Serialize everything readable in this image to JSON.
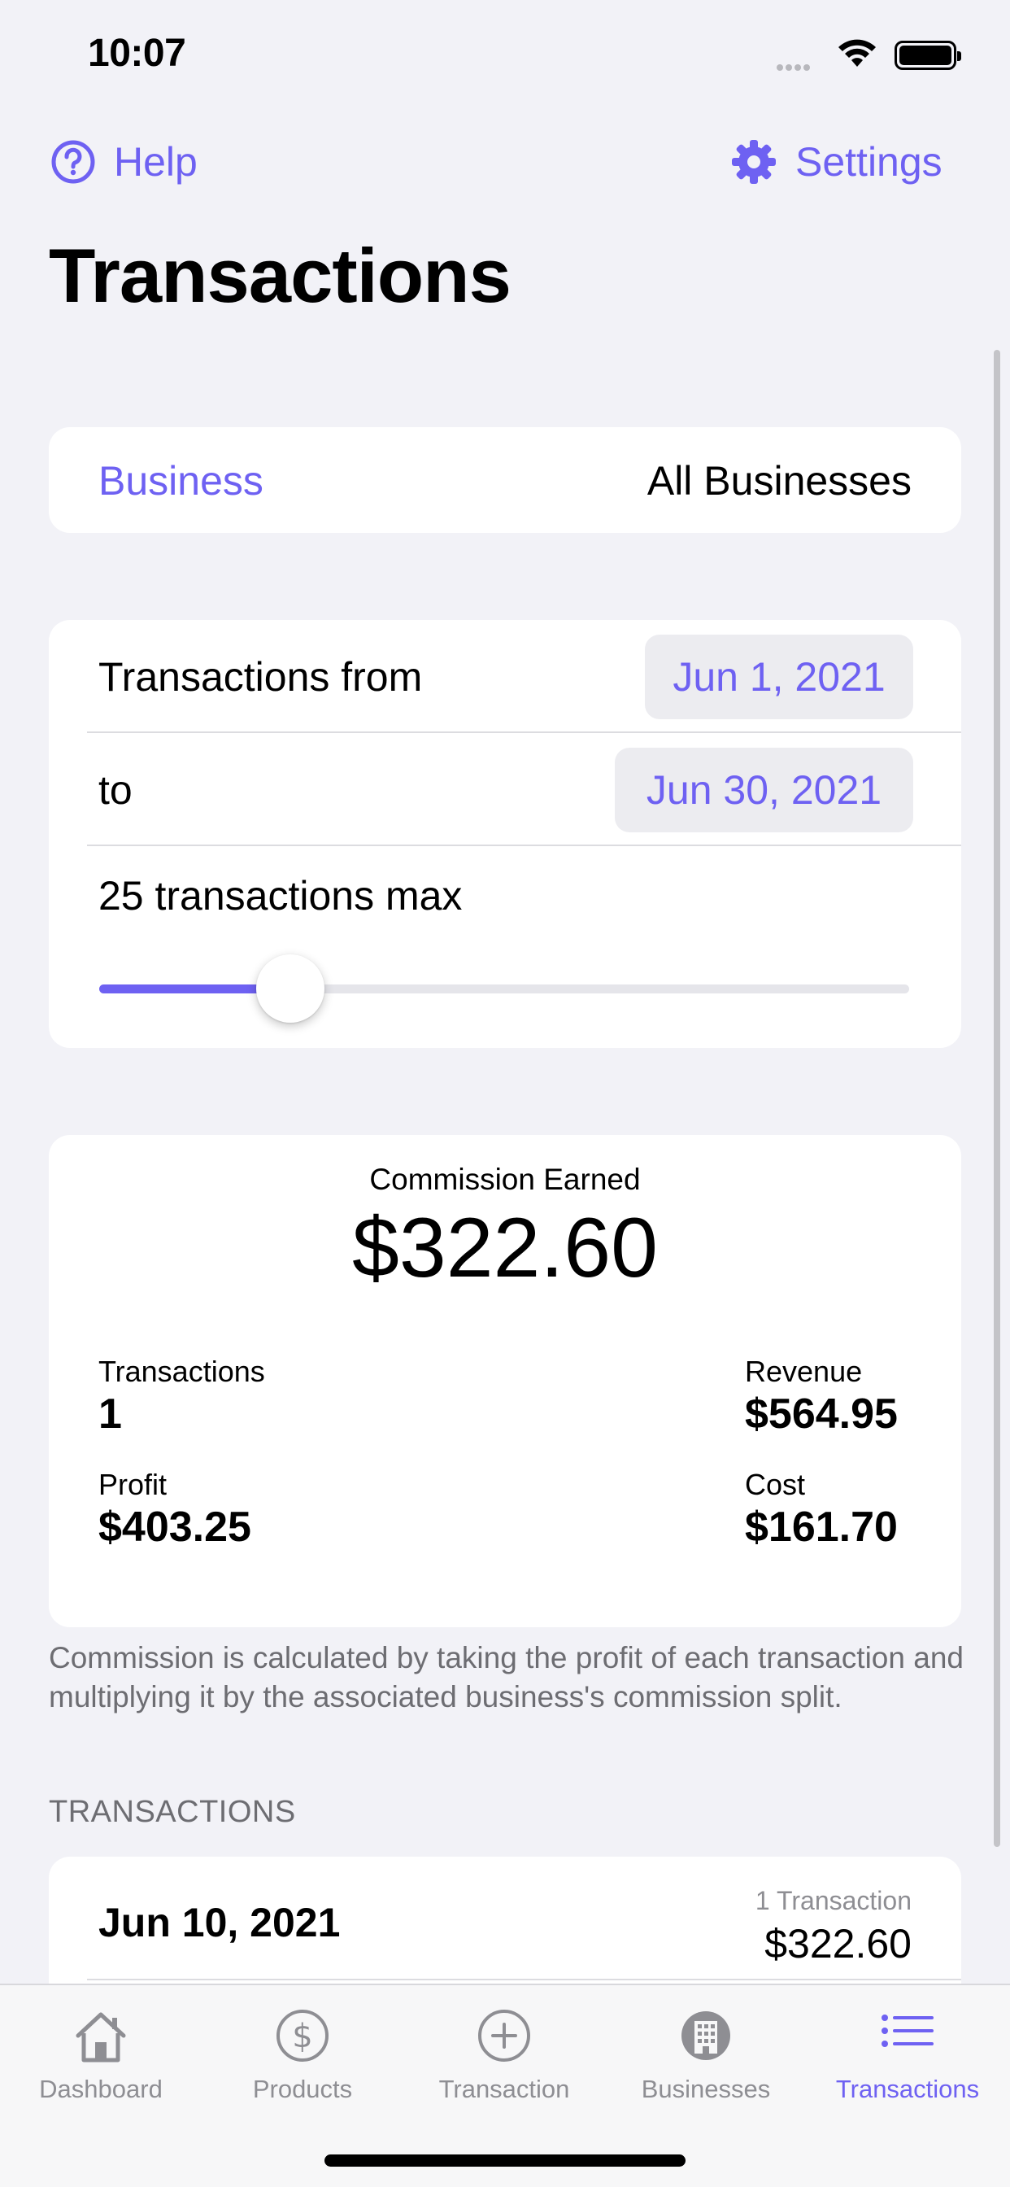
{
  "status_bar": {
    "time": "10:07"
  },
  "nav": {
    "help_label": "Help",
    "settings_label": "Settings"
  },
  "page_title": "Transactions",
  "business_row": {
    "label": "Business",
    "value": "All Businesses"
  },
  "date_range": {
    "from_label": "Transactions from",
    "from_value": "Jun 1, 2021",
    "to_label": "to",
    "to_value": "Jun 30, 2021"
  },
  "max_slider": {
    "label": "25 transactions max",
    "fill_fraction": 0.2
  },
  "summary": {
    "commission_label": "Commission Earned",
    "commission_value": "$322.60",
    "transactions_label": "Transactions",
    "transactions_value": "1",
    "revenue_label": "Revenue",
    "revenue_value": "$564.95",
    "profit_label": "Profit",
    "profit_value": "$403.25",
    "cost_label": "Cost",
    "cost_value": "$161.70"
  },
  "footnote": "Commission is calculated by taking the profit of each transaction and multiplying it by the associated business's commission split.",
  "transactions_section": {
    "header": "TRANSACTIONS",
    "rows": [
      {
        "date": "Jun 10, 2021",
        "count": "1 Transaction",
        "amount": "$322.60"
      }
    ]
  },
  "tab_bar": {
    "tabs": [
      {
        "label": "Dashboard",
        "icon": "house-icon",
        "active": false
      },
      {
        "label": "Products",
        "icon": "dollar-circle-icon",
        "active": false
      },
      {
        "label": "Transaction",
        "icon": "plus-circle-icon",
        "active": false
      },
      {
        "label": "Businesses",
        "icon": "building-circle-icon",
        "active": false
      },
      {
        "label": "Transactions",
        "icon": "list-icon",
        "active": true
      }
    ]
  },
  "colors": {
    "accent": "#6e61f2",
    "background": "#f2f2f7",
    "secondary_text": "#6d6d72",
    "inactive_tab": "#8e8e93"
  }
}
